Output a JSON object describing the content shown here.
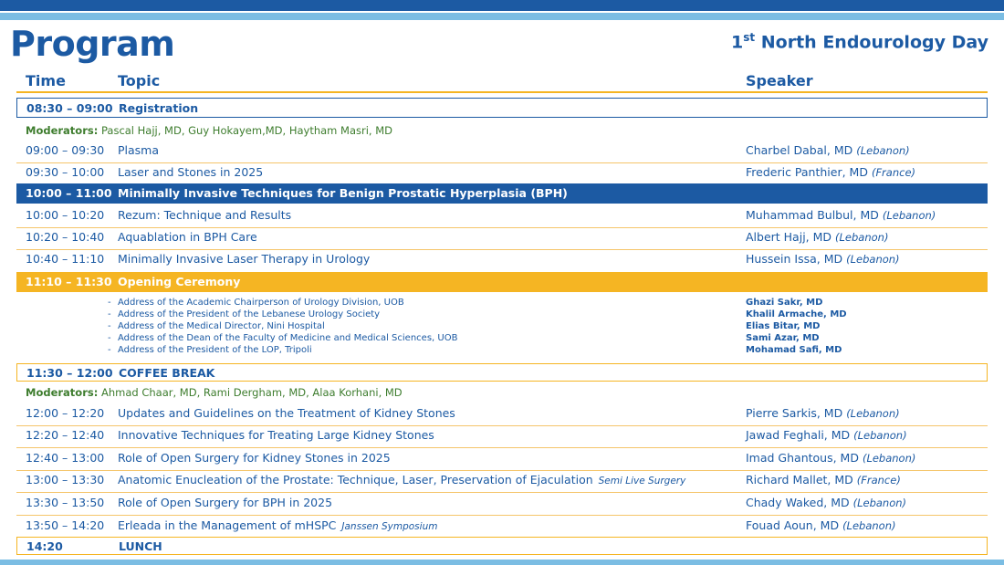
{
  "page": {
    "title": "Program",
    "event_ordinal": "1",
    "event_ordinal_suffix": "st",
    "event_name": " North Endourology Day"
  },
  "columns": {
    "time": "Time",
    "topic": "Topic",
    "speaker": "Speaker"
  },
  "colors": {
    "navy": "#1c5aa3",
    "gold": "#f5b523",
    "light_blue": "#7bbde3",
    "moderator_green": "#3e7d2e"
  },
  "registration": {
    "time": "08:30 – 09:00",
    "topic": "Registration"
  },
  "moderators_1": {
    "label": "Moderators:",
    "names": " Pascal Hajj, MD, Guy Hokayem,MD, Haytham Masri, MD"
  },
  "sessions_1": [
    {
      "time": "09:00 – 09:30",
      "topic": "Plasma",
      "speaker": "Charbel Dabal, MD",
      "country": "(Lebanon)"
    },
    {
      "time": "09:30 – 10:00",
      "topic": "Laser and Stones in 2025",
      "speaker": "Frederic Panthier, MD",
      "country": "(France)"
    }
  ],
  "bph_header": {
    "time": "10:00 – 11:00",
    "topic": "Minimally Invasive Techniques for Benign Prostatic Hyperplasia (BPH)"
  },
  "sessions_2": [
    {
      "time": "10:00 – 10:20",
      "topic": "Rezum: Technique and Results",
      "speaker": "Muhammad Bulbul, MD",
      "country": "(Lebanon)"
    },
    {
      "time": "10:20 – 10:40",
      "topic": "Aquablation in BPH Care",
      "speaker": "Albert Hajj, MD",
      "country": "(Lebanon)"
    },
    {
      "time": "10:40 – 11:10",
      "topic": "Minimally Invasive Laser Therapy in Urology",
      "speaker": "Hussein Issa, MD",
      "country": "(Lebanon)"
    }
  ],
  "opening": {
    "time": "11:10 – 11:30",
    "topic": "Opening Ceremony"
  },
  "addresses": [
    {
      "text": "Address of the Academic Chairperson of Urology Division, UOB",
      "name": "Ghazi Sakr, MD"
    },
    {
      "text": "Address of the President of the Lebanese Urology Society",
      "name": "Khalil Armache, MD"
    },
    {
      "text": "Address of the Medical Director, Nini Hospital",
      "name": "Elias Bitar, MD"
    },
    {
      "text": "Address of the Dean of the Faculty of Medicine and Medical Sciences, UOB",
      "name": "Sami Azar, MD"
    },
    {
      "text": "Address of the President of the LOP, Tripoli",
      "name": "Mohamad Safi, MD"
    }
  ],
  "address_bullet": "-",
  "coffee": {
    "time": "11:30 – 12:00",
    "topic": "COFFEE BREAK"
  },
  "moderators_2": {
    "label": "Moderators:",
    "names": " Ahmad Chaar, MD, Rami Dergham, MD, Alaa Korhani, MD"
  },
  "sessions_3": [
    {
      "time": "12:00 – 12:20",
      "topic": "Updates and Guidelines on the Treatment of Kidney Stones",
      "tag": "",
      "speaker": "Pierre Sarkis, MD",
      "country": "(Lebanon)"
    },
    {
      "time": "12:20 – 12:40",
      "topic": "Innovative Techniques for Treating Large Kidney Stones",
      "tag": "",
      "speaker": "Jawad Feghali, MD",
      "country": "(Lebanon)"
    },
    {
      "time": "12:40 – 13:00",
      "topic": "Role of Open Surgery for Kidney Stones in 2025",
      "tag": "",
      "speaker": "Imad Ghantous, MD",
      "country": "(Lebanon)"
    },
    {
      "time": "13:00 – 13:30",
      "topic": "Anatomic Enucleation of the Prostate: Technique, Laser, Preservation of Ejaculation",
      "tag": "Semi Live Surgery",
      "speaker": "Richard Mallet, MD",
      "country": "(France)"
    },
    {
      "time": "13:30 – 13:50",
      "topic": "Role of Open Surgery for BPH in 2025",
      "tag": "",
      "speaker": "Chady Waked, MD",
      "country": "(Lebanon)"
    },
    {
      "time": "13:50 – 14:20",
      "topic": "Erleada in the Management of mHSPC",
      "tag": "Janssen Symposium",
      "speaker": "Fouad Aoun, MD",
      "country": "(Lebanon)"
    }
  ],
  "lunch": {
    "time": "14:20",
    "topic": "LUNCH"
  }
}
